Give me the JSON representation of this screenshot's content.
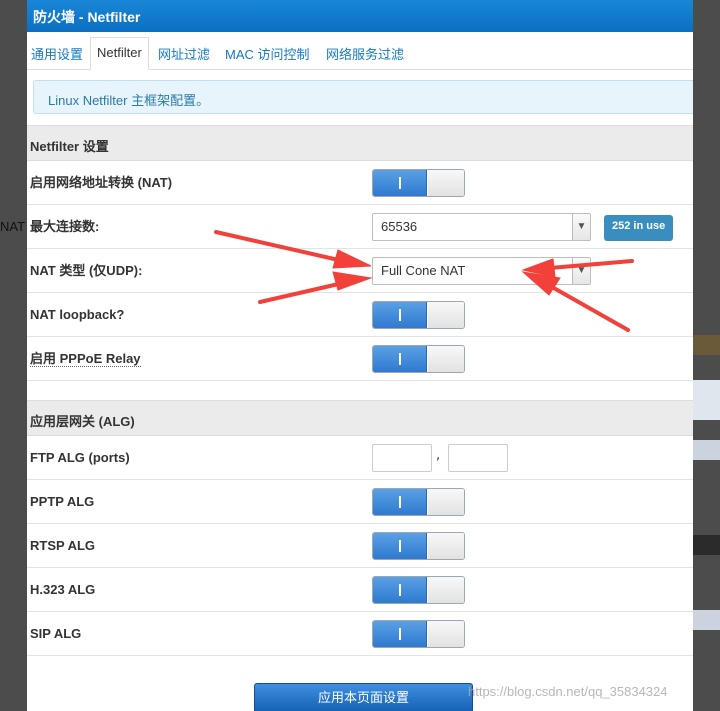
{
  "background": {
    "left_fragment": "NAT"
  },
  "window": {
    "title": "防火墙 - Netfilter"
  },
  "tabs": [
    {
      "label": "通用设置"
    },
    {
      "label": "Netfilter"
    },
    {
      "label": "网址过滤"
    },
    {
      "label": "MAC 访问控制"
    },
    {
      "label": "网络服务过滤"
    }
  ],
  "active_tab": "Netfilter",
  "info_message": "Linux Netfilter 主框架配置。",
  "netfilter_section": {
    "title": "Netfilter 设置",
    "nat_enable": {
      "label": "启用网络地址转换 (NAT)",
      "value": "on"
    },
    "max_connections": {
      "label": "最大连接数:",
      "value": "65536",
      "in_use_badge": "252 in use"
    },
    "nat_type": {
      "label": "NAT 类型 (仅UDP):",
      "value": "Full Cone NAT"
    },
    "nat_loopback": {
      "label": "NAT loopback?",
      "value": "on"
    },
    "pppoe_relay": {
      "label": "启用 PPPoE Relay",
      "value": "on"
    }
  },
  "alg_section": {
    "title": "应用层网关 (ALG)",
    "ftp": {
      "label": "FTP ALG (ports)",
      "port1": "",
      "port2": "",
      "separator": ","
    },
    "pptp": {
      "label": "PPTP ALG",
      "value": "on"
    },
    "rtsp": {
      "label": "RTSP ALG",
      "value": "on"
    },
    "h323": {
      "label": "H.323 ALG",
      "value": "on"
    },
    "sip": {
      "label": "SIP ALG",
      "value": "on"
    }
  },
  "apply_button": "应用本页面设置",
  "watermark": "https://blog.csdn.net/qq_35834324",
  "colors": {
    "accent": "#1479c6",
    "toggle_on": "#3a82d4",
    "badge": "#3a8ebf",
    "annotation_arrow": "#f2403a"
  },
  "annotations": {
    "type": "arrows",
    "count": 4,
    "target": "nat-type-select"
  }
}
